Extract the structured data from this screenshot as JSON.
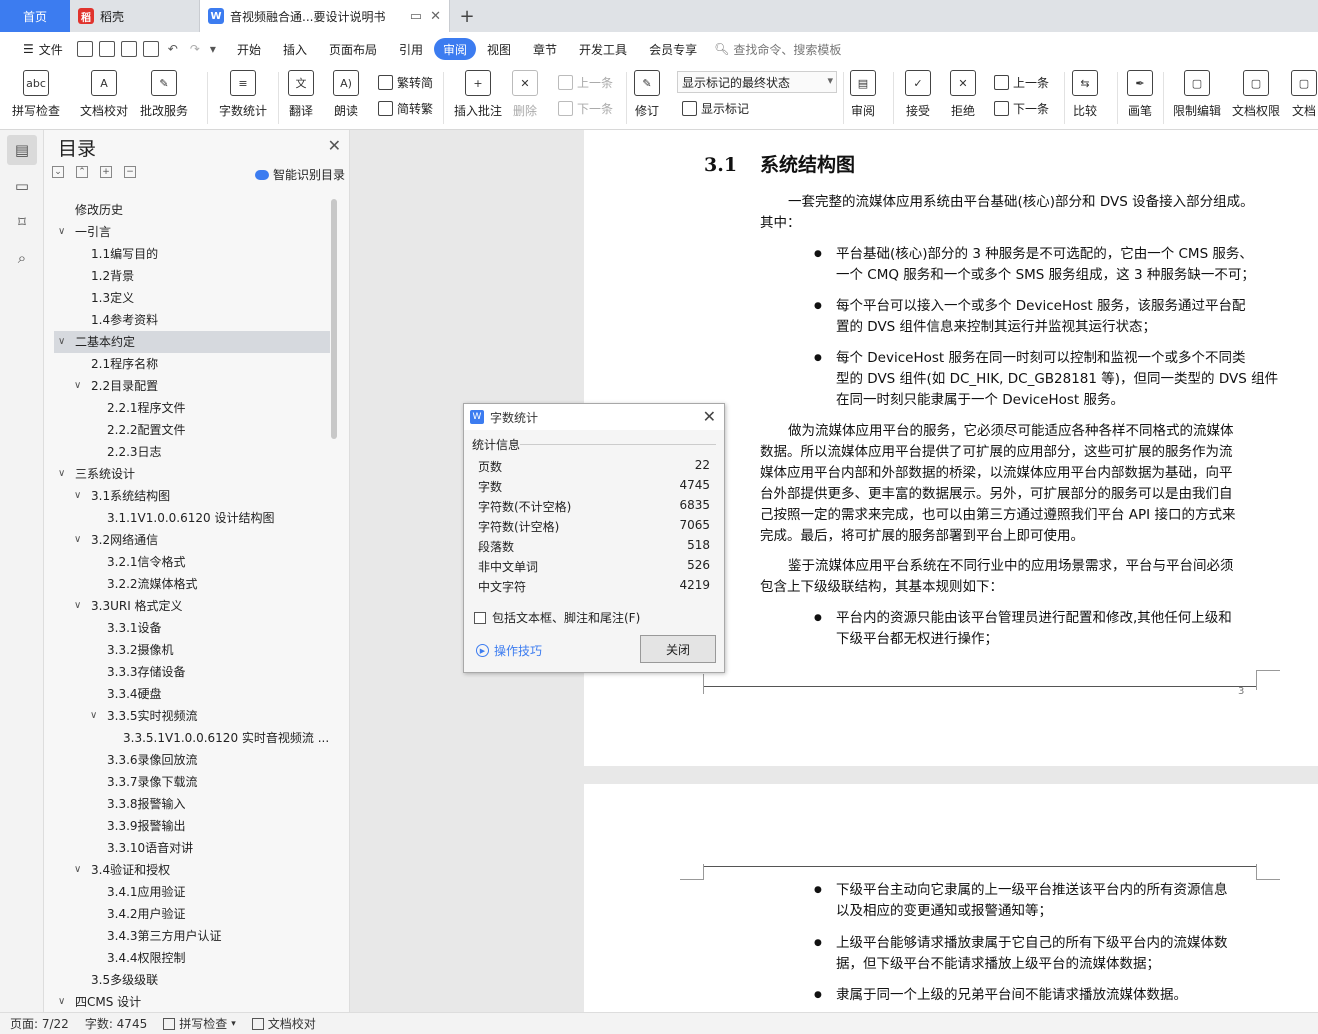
{
  "tabs": {
    "home": "首页",
    "tab1": "稻壳",
    "tab2": "音视频融合通...要设计说明书",
    "tab1_color": "#e0332d",
    "tab2_color": "#3c7cf0"
  },
  "menu": {
    "file": "文件",
    "items": [
      "开始",
      "插入",
      "页面布局",
      "引用",
      "审阅",
      "视图",
      "章节",
      "开发工具",
      "会员专享"
    ],
    "active": "审阅",
    "search": "查找命令、搜索模板"
  },
  "ribbon": {
    "spell": "拼写检查",
    "proof": "文档校对",
    "annotate_service": "批改服务",
    "word_count": "字数统计",
    "translate": "翻译",
    "read": "朗读",
    "to_traditional": "繁转简",
    "to_simplified": "简转繁",
    "insert_comment": "插入批注",
    "delete": "删除",
    "prev": "上一条",
    "next": "下一条",
    "revise": "修订",
    "markup_state": "显示标记的最终状态",
    "show_markup": "显示标记",
    "review": "审阅",
    "accept": "接受",
    "reject": "拒绝",
    "prev2": "上一条",
    "next2": "下一条",
    "compare": "比较",
    "pen": "画笔",
    "restrict_edit": "限制编辑",
    "doc_perm": "文档权限",
    "doc_cut": "文档"
  },
  "toc": {
    "title": "目录",
    "smart": "智能识别目录",
    "items": [
      {
        "t": "修改历史",
        "lv": 0,
        "car": ""
      },
      {
        "t": "一引言",
        "lv": 0,
        "car": "v"
      },
      {
        "t": "1.1编写目的",
        "lv": 1,
        "car": ""
      },
      {
        "t": "1.2背景",
        "lv": 1,
        "car": ""
      },
      {
        "t": "1.3定义",
        "lv": 1,
        "car": ""
      },
      {
        "t": "1.4参考资料",
        "lv": 1,
        "car": ""
      },
      {
        "t": "二基本约定",
        "lv": 0,
        "car": "v",
        "sel": true
      },
      {
        "t": "2.1程序名称",
        "lv": 1,
        "car": ""
      },
      {
        "t": "2.2目录配置",
        "lv": 1,
        "car": "v"
      },
      {
        "t": "2.2.1程序文件",
        "lv": 2,
        "car": ""
      },
      {
        "t": "2.2.2配置文件",
        "lv": 2,
        "car": ""
      },
      {
        "t": "2.2.3日志",
        "lv": 2,
        "car": ""
      },
      {
        "t": "三系统设计",
        "lv": 0,
        "car": "v"
      },
      {
        "t": "3.1系统结构图",
        "lv": 1,
        "car": "v"
      },
      {
        "t": "3.1.1V1.0.0.6120 设计结构图",
        "lv": 2,
        "car": ""
      },
      {
        "t": "3.2网络通信",
        "lv": 1,
        "car": "v"
      },
      {
        "t": "3.2.1信令格式",
        "lv": 2,
        "car": ""
      },
      {
        "t": "3.2.2流媒体格式",
        "lv": 2,
        "car": ""
      },
      {
        "t": "3.3URI 格式定义",
        "lv": 1,
        "car": "v"
      },
      {
        "t": "3.3.1设备",
        "lv": 2,
        "car": ""
      },
      {
        "t": "3.3.2摄像机",
        "lv": 2,
        "car": ""
      },
      {
        "t": "3.3.3存储设备",
        "lv": 2,
        "car": ""
      },
      {
        "t": "3.3.4硬盘",
        "lv": 2,
        "car": ""
      },
      {
        "t": "3.3.5实时视频流",
        "lv": 2,
        "car": "v"
      },
      {
        "t": "3.3.5.1V1.0.0.6120 实时音视频流 ...",
        "lv": 3,
        "car": ""
      },
      {
        "t": "3.3.6录像回放流",
        "lv": 2,
        "car": ""
      },
      {
        "t": "3.3.7录像下载流",
        "lv": 2,
        "car": ""
      },
      {
        "t": "3.3.8报警输入",
        "lv": 2,
        "car": ""
      },
      {
        "t": "3.3.9报警输出",
        "lv": 2,
        "car": ""
      },
      {
        "t": "3.3.10语音对讲",
        "lv": 2,
        "car": ""
      },
      {
        "t": "3.4验证和授权",
        "lv": 1,
        "car": "v"
      },
      {
        "t": "3.4.1应用验证",
        "lv": 2,
        "car": ""
      },
      {
        "t": "3.4.2用户验证",
        "lv": 2,
        "car": ""
      },
      {
        "t": "3.4.3第三方用户认证",
        "lv": 2,
        "car": ""
      },
      {
        "t": "3.4.4权限控制",
        "lv": 2,
        "car": ""
      },
      {
        "t": "3.5多级级联",
        "lv": 1,
        "car": ""
      },
      {
        "t": "四CMS 设计",
        "lv": 0,
        "car": "v"
      }
    ]
  },
  "doc": {
    "h_num": "3.1",
    "h_text": "系统结构图",
    "p1a": "一套完整的流媒体应用系统由平台基础(核心)部分和 DVS 设备接入部分组成。",
    "p1b": "其中：",
    "b1": [
      "平台基础(核心)部分的 3 种服务是不可选配的，它由一个 CMS 服务、",
      "一个 CMQ 服务和一个或多个 SMS 服务组成，这 3 种服务缺一不可；"
    ],
    "b2": [
      "每个平台可以接入一个或多个 DeviceHost 服务，该服务通过平台配",
      "置的 DVS 组件信息来控制其运行并监视其运行状态；"
    ],
    "b3": [
      "每个 DeviceHost 服务在同一时刻可以控制和监视一个或多个不同类",
      "型的 DVS 组件(如 DC_HIK, DC_GB28181 等)，但同一类型的 DVS 组件",
      "在同一时刻只能隶属于一个 DeviceHost 服务。"
    ],
    "p2": [
      "做为流媒体应用平台的服务，它必须尽可能适应各种各样不同格式的流媒体",
      "数据。所以流媒体应用平台提供了可扩展的应用部分，这些可扩展的服务作为流",
      "媒体应用平台内部和外部数据的桥梁，以流媒体应用平台内部数据为基础，向平",
      "台外部提供更多、更丰富的数据展示。另外，可扩展部分的服务可以是由我们自",
      "己按照一定的需求来完成，也可以由第三方通过遵照我们平台 API 接口的方式来",
      "完成。最后，将可扩展的服务部署到平台上即可使用。"
    ],
    "p3": [
      "鉴于流媒体应用平台系统在不同行业中的应用场景需求，平台与平台间必须",
      "包含上下级级联结构，其基本规则如下："
    ],
    "b4": [
      "平台内的资源只能由该平台管理员进行配置和修改,其他任何上级和",
      "下级平台都无权进行操作；"
    ],
    "page_num": "3",
    "b5": [
      "下级平台主动向它隶属的上一级平台推送该平台内的所有资源信息",
      "以及相应的变更通知或报警通知等；"
    ],
    "b6": [
      "上级平台能够请求播放隶属于它自己的所有下级平台内的流媒体数",
      "据，但下级平台不能请求播放上级平台的流媒体数据；"
    ],
    "b7": [
      "隶属于同一个上级的兄弟平台间不能请求播放流媒体数据。"
    ]
  },
  "dialog": {
    "title": "字数统计",
    "section": "统计信息",
    "rows": [
      {
        "k": "页数",
        "v": "22"
      },
      {
        "k": "字数",
        "v": "4745"
      },
      {
        "k": "字符数(不计空格)",
        "v": "6835"
      },
      {
        "k": "字符数(计空格)",
        "v": "7065"
      },
      {
        "k": "段落数",
        "v": "518"
      },
      {
        "k": "非中文单词",
        "v": "526"
      },
      {
        "k": "中文字符",
        "v": "4219"
      }
    ],
    "checkbox": "包括文本框、脚注和尾注(F)",
    "tips": "操作技巧",
    "close": "关闭"
  },
  "status": {
    "page": "页面: 7/22",
    "words": "字数: 4745",
    "spell": "拼写检查",
    "proof": "文档校对"
  }
}
